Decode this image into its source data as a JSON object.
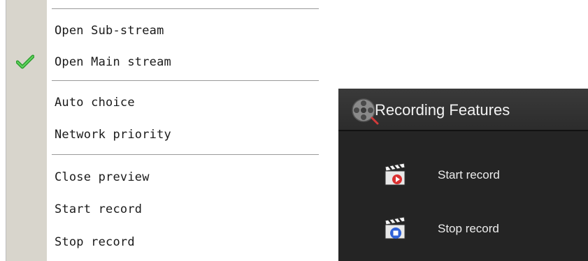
{
  "context_menu": {
    "items": [
      {
        "label": "Open Sub-stream",
        "checked": false
      },
      {
        "label": "Open Main stream",
        "checked": true
      },
      {
        "label": "Auto choice",
        "checked": false
      },
      {
        "label": "Network priority",
        "checked": false
      },
      {
        "label": "Close preview",
        "checked": false
      },
      {
        "label": "Start record",
        "checked": false
      },
      {
        "label": "Stop record",
        "checked": false
      }
    ],
    "check_icon": "green-checkmark-icon",
    "gutter_color": "#d8d5cc"
  },
  "recording_panel": {
    "title": "Recording Features",
    "title_icon": "film-reel-icon",
    "background": "#242424",
    "items": [
      {
        "label": "Start record",
        "icon": "clapperboard-record-icon",
        "accent": "#d93030"
      },
      {
        "label": "Stop record",
        "icon": "clapperboard-stop-icon",
        "accent": "#2f62d8"
      }
    ]
  }
}
